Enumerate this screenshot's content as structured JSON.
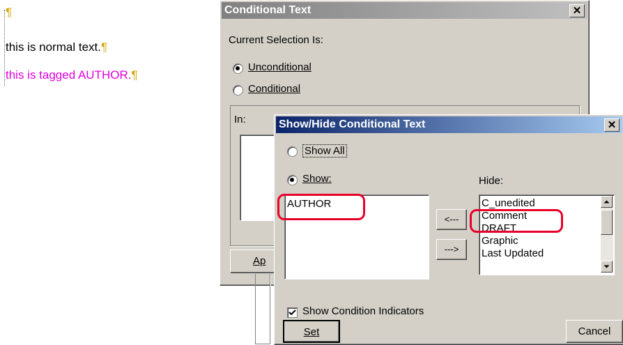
{
  "document": {
    "line1_text": "this is normal text.",
    "line2_text": "this is tagged AUTHOR.",
    "pilcrow": "¶",
    "tagged_color": "#e000e0"
  },
  "conditional_dialog": {
    "title": "Conditional Text",
    "close": "✕",
    "current_selection_label": "Current Selection Is:",
    "unconditional_label": "Unconditional",
    "conditional_label": "Conditional",
    "in_label": "In:",
    "apply_partial": "Ap"
  },
  "showhide_dialog": {
    "title": "Show/Hide Conditional Text",
    "close": "✕",
    "show_all_label": "Show All",
    "show_label": "Show:",
    "hide_label": "Hide:",
    "show_items": [
      "AUTHOR"
    ],
    "hide_items": [
      "C_unedited",
      "Comment",
      "DRAFT",
      "Graphic",
      "Last Updated"
    ],
    "move_left_label": "<---",
    "move_right_label": "--->",
    "show_indicators_label": "Show Condition Indicators",
    "show_indicators_checked": true,
    "set_label": "Set",
    "cancel_label": "Cancel"
  },
  "colors": {
    "annotation": "#e8002a",
    "active_title": "#0a246a"
  }
}
